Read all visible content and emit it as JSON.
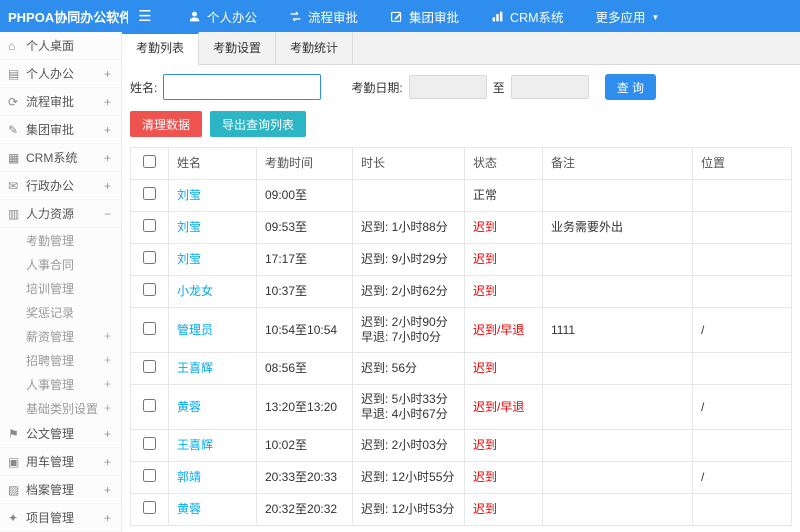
{
  "colors": {
    "navbar_blue": "#2e8ded",
    "link_blue": "#01AAED",
    "status_red": "#e60000",
    "danger_red": "#ef5350",
    "export_teal": "#2bb5c5"
  },
  "navbar": {
    "logo": "PHPOA协同办公软件",
    "items": [
      {
        "label": "个人办公",
        "icon": "user-icon"
      },
      {
        "label": "流程审批",
        "icon": "flow-icon"
      },
      {
        "label": "集团审批",
        "icon": "approve-edit-icon"
      },
      {
        "label": "CRM系统",
        "icon": "chart-icon"
      },
      {
        "label": "更多应用",
        "icon": "caret-down-icon"
      }
    ]
  },
  "sidebar": {
    "items": [
      {
        "label": "个人桌面",
        "icon": "desktop-icon",
        "toggle": ""
      },
      {
        "label": "个人办公",
        "icon": "personal-office-icon",
        "toggle": "+"
      },
      {
        "label": "流程审批",
        "icon": "process-approval-icon",
        "toggle": "+"
      },
      {
        "label": "集团审批",
        "icon": "group-approval-icon",
        "toggle": "+"
      },
      {
        "label": "CRM系统",
        "icon": "crm-icon",
        "toggle": "+"
      },
      {
        "label": "行政办公",
        "icon": "admin-office-icon",
        "toggle": "+"
      },
      {
        "label": "人力资源",
        "icon": "hr-icon",
        "toggle": "−",
        "children": [
          {
            "label": "考勤管理",
            "toggle": ""
          },
          {
            "label": "人事合同",
            "toggle": ""
          },
          {
            "label": "培训管理",
            "toggle": ""
          },
          {
            "label": "奖惩记录",
            "toggle": ""
          },
          {
            "label": "薪资管理",
            "toggle": "+"
          },
          {
            "label": "招聘管理",
            "toggle": "+"
          },
          {
            "label": "人事管理",
            "toggle": "+"
          },
          {
            "label": "基础类别设置",
            "toggle": "+"
          }
        ]
      },
      {
        "label": "公文管理",
        "icon": "document-icon",
        "toggle": "+"
      },
      {
        "label": "用车管理",
        "icon": "vehicle-icon",
        "toggle": "+"
      },
      {
        "label": "档案管理",
        "icon": "archive-icon",
        "toggle": "+"
      },
      {
        "label": "项目管理",
        "icon": "project-icon",
        "toggle": "+"
      }
    ]
  },
  "tabs": [
    {
      "label": "考勤列表",
      "active": true
    },
    {
      "label": "考勤设置",
      "active": false
    },
    {
      "label": "考勤统计",
      "active": false
    }
  ],
  "filters": {
    "name_label": "姓名:",
    "date_label": "考勤日期:",
    "to_label": "至",
    "search_button": "查 询"
  },
  "actions": {
    "clean_button": "清理数据",
    "export_button": "导出查询列表"
  },
  "table": {
    "columns": [
      "姓名",
      "考勤时间",
      "时长",
      "状态",
      "备注",
      "位置"
    ],
    "rows": [
      {
        "name": "刘莹",
        "time": "09:00至",
        "duration": [],
        "status": "正常",
        "note": "",
        "location": ""
      },
      {
        "name": "刘莹",
        "time": "09:53至",
        "duration": [
          "迟到: 1小时88分"
        ],
        "status": "迟到",
        "note": "业务需要外出",
        "location": ""
      },
      {
        "name": "刘莹",
        "time": "17:17至",
        "duration": [
          "迟到: 9小时29分"
        ],
        "status": "迟到",
        "note": "",
        "location": ""
      },
      {
        "name": "小龙女",
        "time": "10:37至",
        "duration": [
          "迟到: 2小时62分"
        ],
        "status": "迟到",
        "note": "",
        "location": ""
      },
      {
        "name": "管理员",
        "time": "10:54至10:54",
        "duration": [
          "迟到: 2小时90分",
          "早退: 7小时0分"
        ],
        "status": "迟到/早退",
        "note": "1111",
        "location": "/"
      },
      {
        "name": "王喜辉",
        "time": "08:56至",
        "duration": [
          "迟到: 56分"
        ],
        "status": "迟到",
        "note": "",
        "location": ""
      },
      {
        "name": "黄蓉",
        "time": "13:20至13:20",
        "duration": [
          "迟到: 5小时33分",
          "早退: 4小时67分"
        ],
        "status": "迟到/早退",
        "note": "",
        "location": "/"
      },
      {
        "name": "王喜辉",
        "time": "10:02至",
        "duration": [
          "迟到: 2小时03分"
        ],
        "status": "迟到",
        "note": "",
        "location": ""
      },
      {
        "name": "郭靖",
        "time": "20:33至20:33",
        "duration": [
          "迟到: 12小时55分"
        ],
        "status": "迟到",
        "note": "",
        "location": "/"
      },
      {
        "name": "黄蓉",
        "time": "20:32至20:32",
        "duration": [
          "迟到: 12小时53分"
        ],
        "status": "迟到",
        "note": "",
        "location": ""
      }
    ]
  }
}
